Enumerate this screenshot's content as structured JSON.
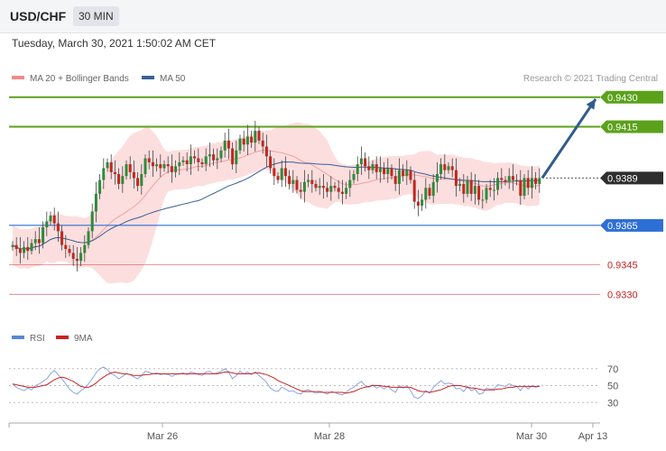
{
  "header": {
    "pair": "USD/CHF",
    "timeframe": "30 MIN"
  },
  "timestamp": "Tuesday, March 30, 2021 1:50:02 AM CET",
  "chart_data": {
    "type": "candlestick",
    "legend": [
      "MA 20 + Bollinger Bands",
      "MA 50"
    ],
    "copyright": "Research © 2021 Trading Central",
    "price_axis": {
      "min": 0.931,
      "max": 0.9445
    },
    "levels": [
      {
        "label": "0.9430",
        "value": 0.943,
        "kind": "resistance",
        "color": "#5ba11a"
      },
      {
        "label": "0.9415",
        "value": 0.9415,
        "kind": "resistance",
        "color": "#5ba11a"
      },
      {
        "label": "0.9389",
        "value": 0.9389,
        "kind": "last",
        "color": "#2e2e2e"
      },
      {
        "label": "0.9365",
        "value": 0.9365,
        "kind": "pivot",
        "color": "#2e6fd6"
      },
      {
        "label": "0.9345",
        "value": 0.9345,
        "kind": "support",
        "color": "#cc2222"
      },
      {
        "label": "0.9330",
        "value": 0.933,
        "kind": "support",
        "color": "#cc2222"
      }
    ],
    "closes": [
      0.9355,
      0.9353,
      0.9351,
      0.9354,
      0.9352,
      0.9356,
      0.9358,
      0.9356,
      0.9364,
      0.9367,
      0.937,
      0.9366,
      0.9362,
      0.9355,
      0.9353,
      0.9351,
      0.9348,
      0.9347,
      0.9351,
      0.9355,
      0.9362,
      0.9372,
      0.9381,
      0.9388,
      0.9394,
      0.9397,
      0.9392,
      0.9391,
      0.9386,
      0.939,
      0.9396,
      0.9392,
      0.9389,
      0.9385,
      0.9391,
      0.9399,
      0.9397,
      0.9395,
      0.9396,
      0.9394,
      0.9396,
      0.9395,
      0.9392,
      0.9395,
      0.9397,
      0.9398,
      0.9396,
      0.94,
      0.9399,
      0.9397,
      0.9396,
      0.94,
      0.9401,
      0.9398,
      0.9399,
      0.9403,
      0.9408,
      0.9404,
      0.9396,
      0.9403,
      0.9409,
      0.9406,
      0.941,
      0.9407,
      0.9413,
      0.9408,
      0.9405,
      0.94,
      0.9394,
      0.939,
      0.9388,
      0.9394,
      0.939,
      0.9386,
      0.9388,
      0.9383,
      0.9382,
      0.9387,
      0.9388,
      0.9386,
      0.9384,
      0.9385,
      0.9384,
      0.9382,
      0.9385,
      0.9384,
      0.9382,
      0.9381,
      0.9384,
      0.9388,
      0.9391,
      0.9396,
      0.9399,
      0.9395,
      0.9393,
      0.9396,
      0.9392,
      0.9394,
      0.9391,
      0.9394,
      0.939,
      0.9386,
      0.9393,
      0.939,
      0.9393,
      0.9388,
      0.9377,
      0.9375,
      0.9378,
      0.9384,
      0.938,
      0.9387,
      0.9391,
      0.9396,
      0.9393,
      0.9395,
      0.9393,
      0.9385,
      0.9386,
      0.9381,
      0.9388,
      0.9381,
      0.9385,
      0.9378,
      0.9378,
      0.9384,
      0.9383,
      0.9383,
      0.9389,
      0.9388,
      0.9387,
      0.939,
      0.9388,
      0.9388,
      0.938,
      0.9389,
      0.9384,
      0.9389,
      0.9386,
      0.9389
    ],
    "rsi": {
      "legend": [
        "RSI",
        "9MA"
      ],
      "ticks": [
        70,
        50,
        30
      ],
      "values": [
        52,
        48,
        46,
        44,
        47,
        45,
        50,
        52,
        55,
        58,
        64,
        68,
        63,
        58,
        52,
        46,
        42,
        40,
        44,
        47,
        52,
        58,
        65,
        70,
        72,
        69,
        64,
        62,
        58,
        61,
        64,
        63,
        60,
        58,
        62,
        67,
        66,
        64,
        65,
        63,
        64,
        63,
        61,
        63,
        64,
        65,
        63,
        66,
        65,
        63,
        62,
        66,
        67,
        64,
        65,
        67,
        70,
        66,
        58,
        62,
        67,
        64,
        66,
        63,
        66,
        62,
        58,
        54,
        47,
        44,
        43,
        48,
        46,
        43,
        44,
        41,
        40,
        44,
        45,
        43,
        41,
        42,
        42,
        40,
        43,
        42,
        40,
        39,
        42,
        46,
        48,
        52,
        55,
        50,
        48,
        51,
        47,
        49,
        46,
        49,
        45,
        42,
        50,
        47,
        50,
        44,
        36,
        35,
        38,
        44,
        41,
        48,
        52,
        56,
        52,
        53,
        52,
        46,
        47,
        43,
        49,
        44,
        46,
        40,
        41,
        47,
        46,
        46,
        51,
        50,
        49,
        52,
        50,
        49,
        44,
        50,
        46,
        50,
        48,
        50
      ],
      "ma": [
        52,
        51,
        50,
        49,
        48,
        48,
        48,
        49,
        50,
        51,
        54,
        57,
        59,
        60,
        59,
        57,
        55,
        52,
        49,
        48,
        48,
        50,
        53,
        57,
        60,
        63,
        65,
        66,
        65,
        64,
        64,
        63,
        62,
        62,
        62,
        63,
        63,
        64,
        64,
        64,
        64,
        64,
        64,
        64,
        64,
        64,
        64,
        64,
        64,
        64,
        64,
        64,
        64,
        64,
        64,
        65,
        66,
        66,
        65,
        64,
        64,
        64,
        64,
        64,
        65,
        65,
        64,
        63,
        61,
        59,
        56,
        54,
        52,
        50,
        48,
        46,
        44,
        43,
        43,
        43,
        43,
        43,
        42,
        42,
        42,
        42,
        42,
        42,
        41,
        42,
        43,
        45,
        47,
        48,
        49,
        50,
        50,
        50,
        49,
        49,
        48,
        48,
        48,
        48,
        48,
        48,
        46,
        44,
        43,
        43,
        42,
        43,
        44,
        45,
        47,
        49,
        50,
        50,
        50,
        49,
        48,
        47,
        47,
        46,
        45,
        45,
        45,
        45,
        46,
        46,
        47,
        48,
        48,
        49,
        49,
        49,
        49,
        49,
        49,
        49
      ]
    },
    "x_axis_labels": [
      "Mar 26",
      "Mar 28",
      "Mar 30",
      "Apr 13"
    ]
  }
}
